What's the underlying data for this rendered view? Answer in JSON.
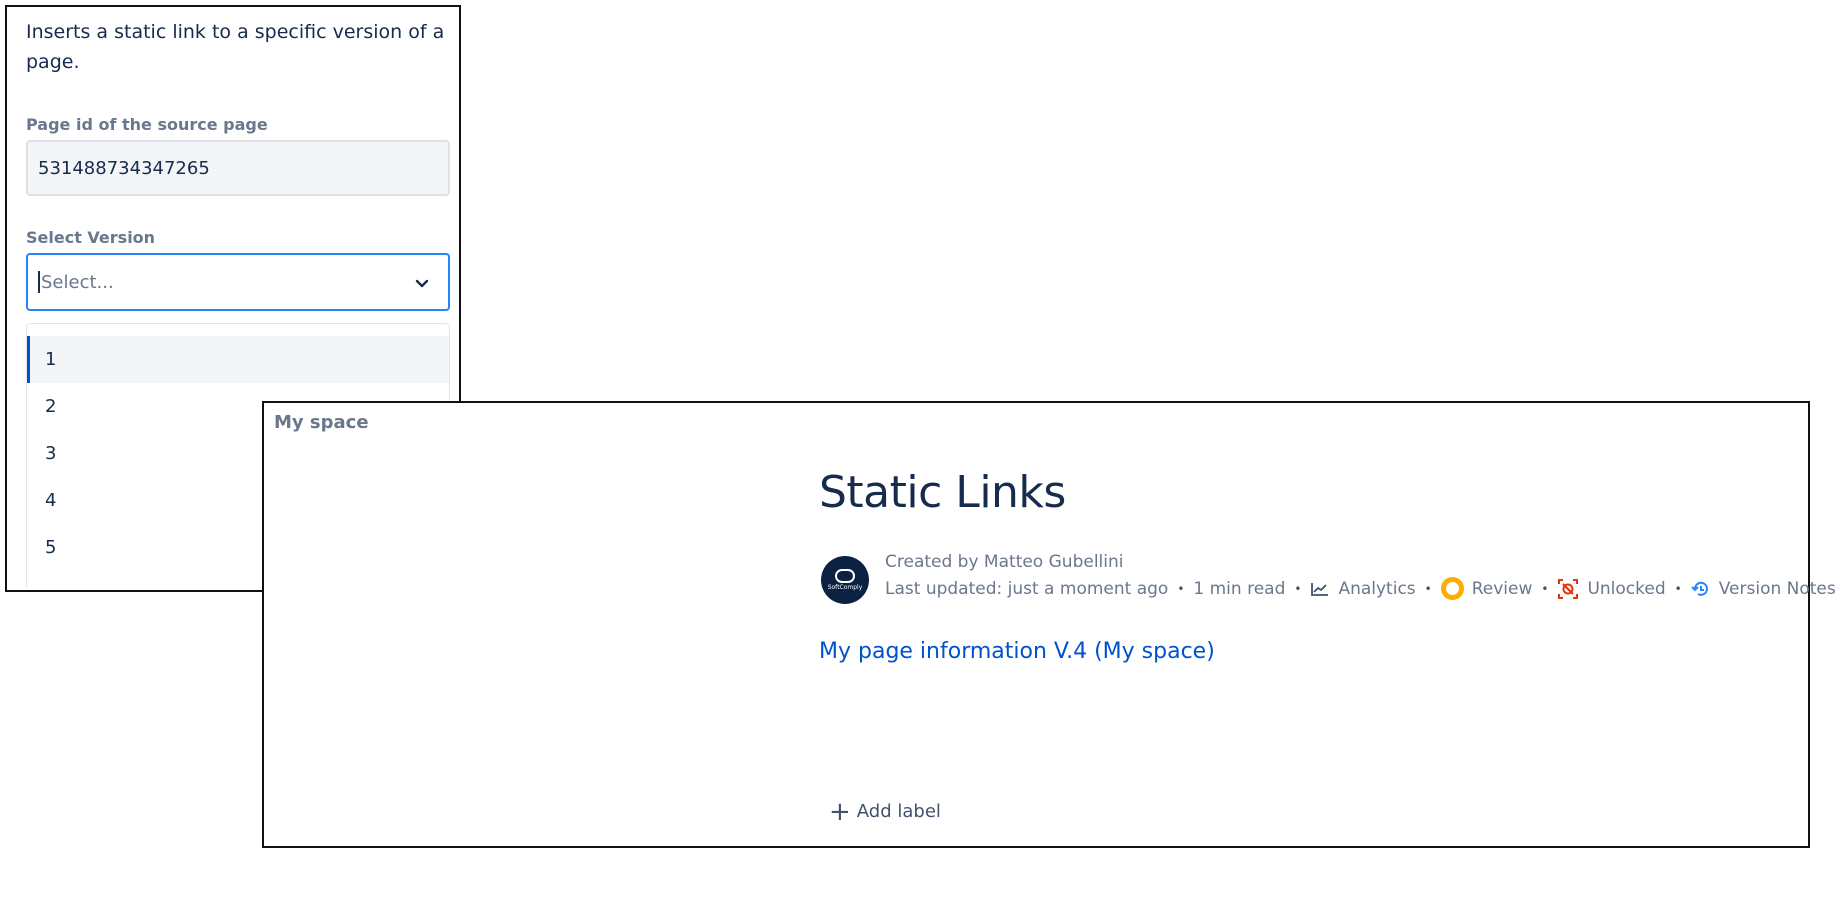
{
  "macro_config": {
    "description": "Inserts a static link to a specific version of a page.",
    "page_id_label": "Page id of the source page",
    "page_id_value": "531488734347265",
    "select_version_label": "Select Version",
    "select_placeholder": "Select...",
    "version_options": [
      "1",
      "2",
      "3",
      "4",
      "5"
    ]
  },
  "page": {
    "space_name": "My space",
    "title": "Static Links",
    "avatar_text": "SoftComply",
    "byline": "Created by Matteo Gubellini",
    "last_updated": "Last updated: just a moment ago",
    "read_time": "1 min read",
    "analytics_label": "Analytics",
    "review_label": "Review",
    "unlocked_label": "Unlocked",
    "version_notes_label": "Version Notes",
    "static_link_text": "My page information V.4 (My space)",
    "add_label": "Add label"
  },
  "colors": {
    "link": "#0052cc",
    "focus_border": "#2684ff",
    "review": "#ffab00",
    "unlocked": "#de350b"
  }
}
